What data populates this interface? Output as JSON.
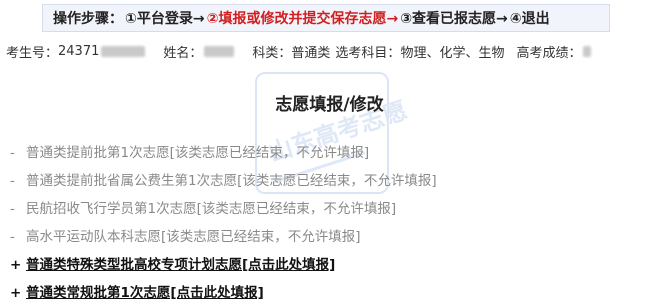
{
  "steps": {
    "label": "操作步骤：",
    "step1": "①平台登录→",
    "step2": "②填报或修改并提交保存志愿→",
    "step3": "③查看已报志愿→",
    "step4": "④退出",
    "accent_color": "#d11f1f"
  },
  "candidate": {
    "exam_no_label": "考生号：",
    "exam_no_value": "24371",
    "name_label": "姓名：",
    "category_label": "科类：",
    "category_value": "普通类",
    "subjects_label": "选考科目：",
    "subjects_value": "物理、化学、生物",
    "score_label": "高考成绩：",
    "score_value": ""
  },
  "page_title": "志愿填报/修改",
  "watermark": {
    "text": "山东高考志愿",
    "color": "#bfd1ee"
  },
  "volunteer_items": [
    {
      "bullet": "-",
      "text": "普通类提前批第1次志愿[该类志愿已经结束，不允许填报]",
      "status": "closed"
    },
    {
      "bullet": "-",
      "text": "普通类提前批省属公费生第1次志愿[该类志愿已经结束，不允许填报]",
      "status": "closed"
    },
    {
      "bullet": "-",
      "text": "民航招收飞行学员第1次志愿[该类志愿已经结束，不允许填报]",
      "status": "closed"
    },
    {
      "bullet": "-",
      "text": "高水平运动队本科志愿[该类志愿已经结束，不允许填报]",
      "status": "closed"
    },
    {
      "bullet": "+",
      "text": "普通类特殊类型批高校专项计划志愿[点击此处填报]",
      "status": "open"
    },
    {
      "bullet": "+",
      "text": "普通类常规批第1次志愿[点击此处填报]",
      "status": "open"
    }
  ]
}
